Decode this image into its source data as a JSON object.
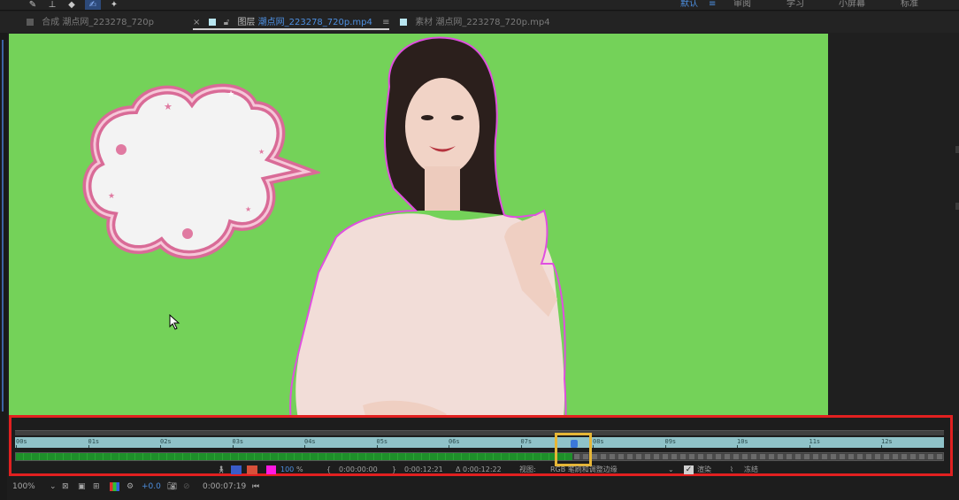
{
  "toolbar": {
    "workspaces": [
      {
        "label": "默认",
        "active": true
      },
      {
        "label": "≡",
        "active": true
      },
      {
        "label": "审阅",
        "active": false
      },
      {
        "label": "学习",
        "active": false
      },
      {
        "label": "小屏幕",
        "active": false
      },
      {
        "label": "标准",
        "active": false
      }
    ]
  },
  "tabs": [
    {
      "prefix": "合成",
      "name": "潮点网_223278_720p",
      "active": false
    },
    {
      "prefix": "图层",
      "name": "潮点网_223278_720p.mp4",
      "menu": "≡",
      "active": true
    },
    {
      "prefix": "素材",
      "name": "潮点网_223278_720p.mp4",
      "active": false
    }
  ],
  "refine": {
    "ticks": [
      "00s",
      "01s",
      "02s",
      "03s",
      "04s",
      "05s",
      "06s",
      "07s",
      "08s",
      "09s",
      "10s",
      "11s",
      "12s"
    ],
    "progress": 0.6,
    "zoom": "100",
    "zoom_unit": "%",
    "in_time": "0:00:00:00",
    "out_time": "0:00:12:21",
    "duration": "Δ 0:00:12:22",
    "view_label": "视图:",
    "view_value": "RGB 笔刷和调整边缘",
    "render_label": "渲染",
    "freeze_label": "冻结"
  },
  "status": {
    "zoom": "100%",
    "exposure": "+0.0",
    "timecode": "0:00:07:19"
  },
  "colors": {
    "screen_green": "#74d259",
    "highlight_red": "#e12020",
    "highlight_yellow": "#e6b636",
    "accent_blue": "#4d8fe0"
  }
}
